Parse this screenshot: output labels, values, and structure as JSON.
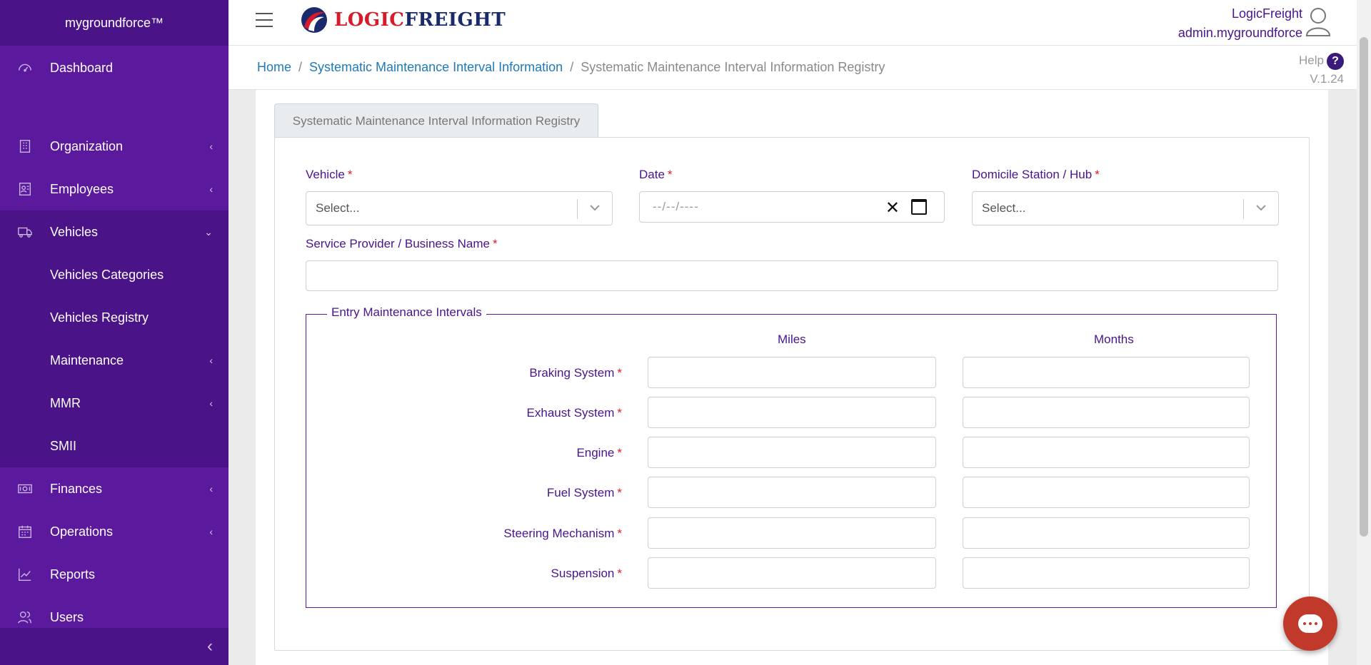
{
  "sidebar": {
    "brand": "mygroundforce™",
    "items": [
      {
        "label": "Dashboard",
        "icon": "gauge-icon",
        "chevron": ""
      },
      {
        "label": "Organization",
        "icon": "building-icon",
        "chevron": "‹"
      },
      {
        "label": "Employees",
        "icon": "id-card-icon",
        "chevron": "‹"
      },
      {
        "label": "Vehicles",
        "icon": "truck-icon",
        "chevron": "⌄"
      },
      {
        "label": "Vehicles Categories"
      },
      {
        "label": "Vehicles Registry"
      },
      {
        "label": "Maintenance",
        "chevron": "‹"
      },
      {
        "label": "MMR",
        "chevron": "‹"
      },
      {
        "label": "SMII"
      },
      {
        "label": "Finances",
        "icon": "money-icon",
        "chevron": "‹"
      },
      {
        "label": "Operations",
        "icon": "calendar-icon",
        "chevron": "‹"
      },
      {
        "label": "Reports",
        "icon": "chart-icon",
        "chevron": ""
      },
      {
        "label": "Users",
        "icon": "users-icon",
        "chevron": ""
      }
    ],
    "collapse": "‹"
  },
  "topbar": {
    "logo_red": "LOGIC",
    "logo_navy": "FREIGHT",
    "user_name": "LogicFreight",
    "user_account": "admin.mygroundforce"
  },
  "breadcrumb": {
    "home": "Home",
    "sep": "/",
    "parent": "Systematic Maintenance Interval Information",
    "current": "Systematic Maintenance Interval Information Registry"
  },
  "help": {
    "label": "Help",
    "icon": "?",
    "version": "V.1.24"
  },
  "tab": {
    "label": "Systematic Maintenance Interval Information Registry"
  },
  "form": {
    "required_mark": "*",
    "vehicle_label": "Vehicle",
    "vehicle_placeholder": "Select...",
    "date_label": "Date",
    "date_placeholder": "--/--/----",
    "date_clear": "✕",
    "hub_label": "Domicile Station / Hub",
    "hub_placeholder": "Select...",
    "provider_label": "Service Provider / Business Name",
    "provider_value": ""
  },
  "intervals": {
    "legend": "Entry Maintenance Intervals",
    "col_miles": "Miles",
    "col_months": "Months",
    "rows": [
      {
        "label": "Braking System",
        "miles": "",
        "months": ""
      },
      {
        "label": "Exhaust System",
        "miles": "",
        "months": ""
      },
      {
        "label": "Engine",
        "miles": "",
        "months": ""
      },
      {
        "label": "Fuel System",
        "miles": "",
        "months": ""
      },
      {
        "label": "Steering Mechanism",
        "miles": "",
        "months": ""
      },
      {
        "label": "Suspension",
        "miles": "",
        "months": ""
      }
    ]
  },
  "colors": {
    "sidebar": "#5b1a9e",
    "sidebar_dark": "#4a1387",
    "label": "#4a148c",
    "required": "#d81b2a",
    "link": "#1f7ab8",
    "chat": "#c0392b"
  }
}
